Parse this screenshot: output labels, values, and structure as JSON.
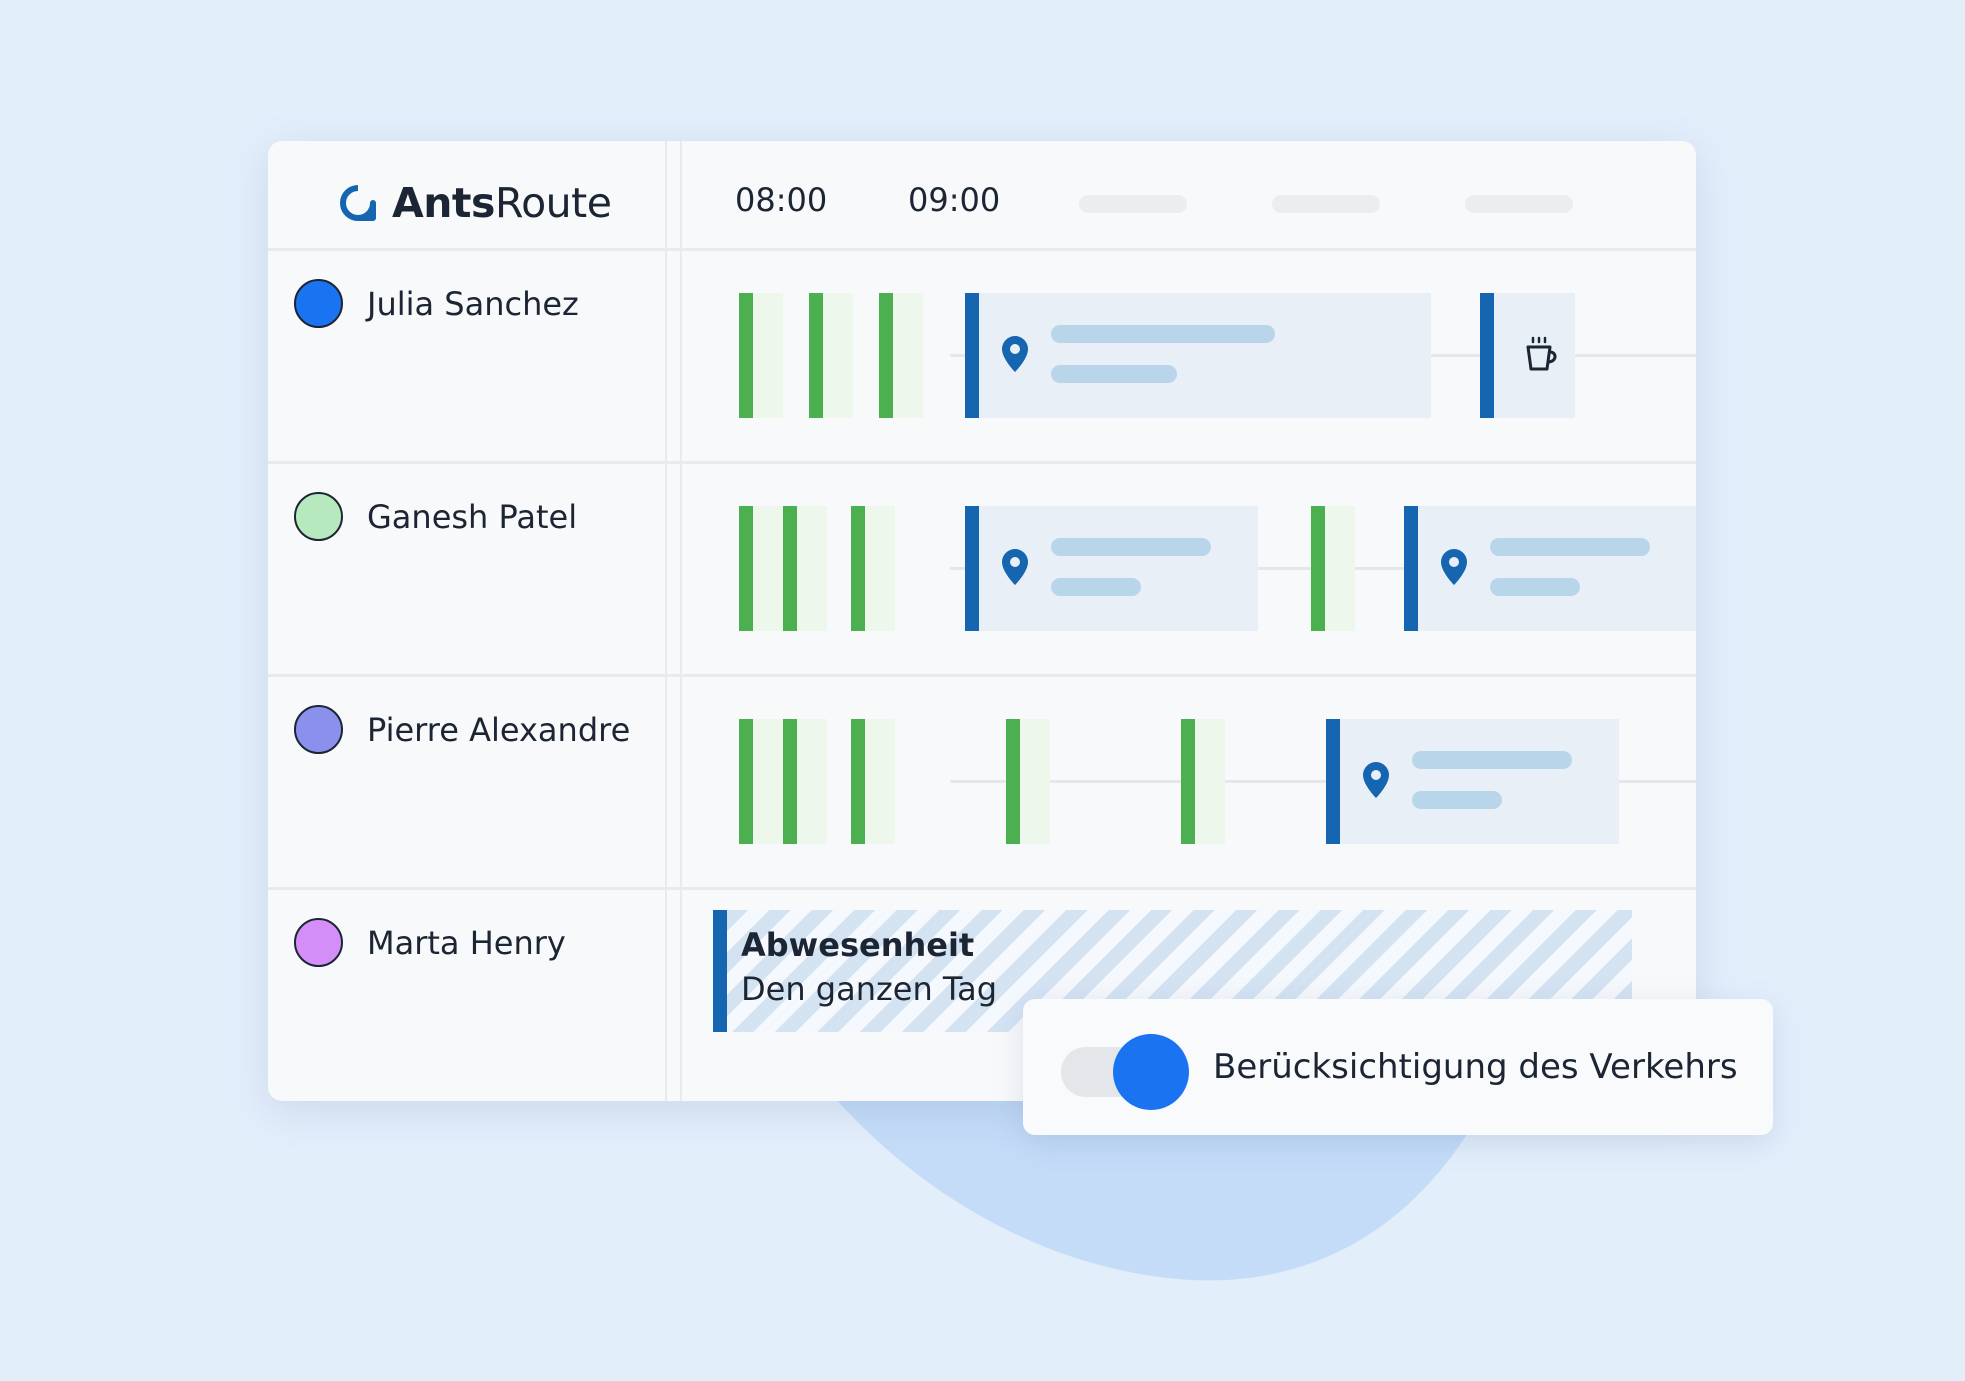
{
  "app": {
    "name_bold": "Ants",
    "name_regular": "Route",
    "brand_color": "#1565b0"
  },
  "timeline": {
    "hours": [
      "08:00",
      "09:00"
    ]
  },
  "agents": [
    {
      "name": "Julia Sanchez",
      "color": "#1a73f0"
    },
    {
      "name": "Ganesh Patel",
      "color": "#b6e9bd"
    },
    {
      "name": "Pierre Alexandre",
      "color": "#8a90ec"
    },
    {
      "name": "Marta Henry",
      "color": "#d48ef7"
    }
  ],
  "icons": {
    "visit": "location-pin-icon",
    "break": "coffee-cup-icon"
  },
  "absence": {
    "title": "Abwesenheit",
    "subtitle": "Den ganzen Tag"
  },
  "traffic_toggle": {
    "label": "Berücksichtigung des Verkehrs",
    "enabled": true,
    "accent_color": "#1a73f0"
  },
  "colors": {
    "stop": "#4caf50",
    "visit_accent": "#1565b0",
    "background": "#e3eefb"
  }
}
